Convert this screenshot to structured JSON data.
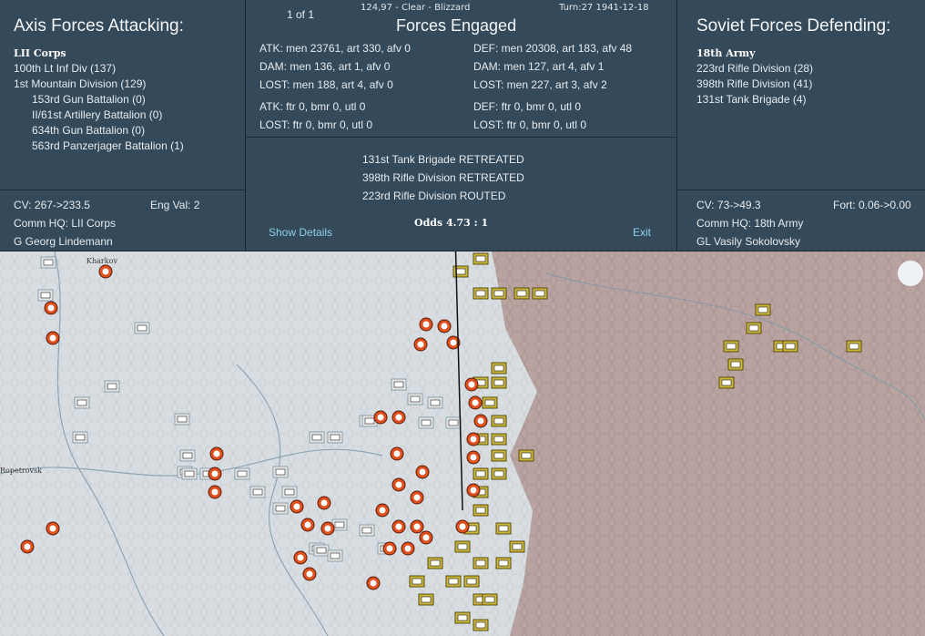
{
  "attacker": {
    "heading": "Axis Forces Attacking:",
    "hq_name": "LII Corps",
    "units": [
      "100th Lt Inf Div (137)",
      "1st Mountain Division (129)",
      "153rd Gun Battalion (0)",
      "II/61st Artillery Battalion (0)",
      "634th Gun Battalion (0)",
      "563rd Panzerjager Battalion (1)"
    ],
    "cv": "CV: 267->233.5",
    "eng_val": "Eng Val: 2",
    "comm_hq": "Comm HQ: LII Corps",
    "commander": "G Georg Lindemann"
  },
  "engagement": {
    "page": "1 of 1",
    "coords_weather": "124,97 - Clear - Blizzard",
    "turn": "Turn:27  1941-12-18",
    "heading": "Forces Engaged",
    "atk": "ATK: men 23761, art 330, afv 0",
    "dam_atk": "DAM: men 136, art 1, afv 0",
    "lost_atk": "LOST: men 188, art 4, afv 0",
    "atk_air": "ATK: ftr 0, bmr 0, utl 0",
    "lost_atk_air": "LOST: ftr 0, bmr 0, utl 0",
    "def": "DEF: men 20308, art 183, afv 48",
    "dam_def": "DAM: men 127, art 4, afv 1",
    "lost_def": "LOST: men 227, art 3, afv 2",
    "def_air": "DEF: ftr 0, bmr 0, utl 0",
    "lost_def_air": "LOST: ftr 0, bmr 0, utl 0",
    "results": [
      "131st Tank Brigade RETREATED",
      "398th Rifle Division RETREATED",
      "223rd Rifle Division ROUTED"
    ],
    "show_details": "Show Details",
    "odds": "Odds 4.73 : 1",
    "exit": "Exit"
  },
  "defender": {
    "heading": "Soviet Forces Defending:",
    "hq_name": "18th Army",
    "units": [
      "223rd Rifle Division (28)",
      "398th Rifle Division (41)",
      "131st Tank Brigade (4)"
    ],
    "cv": "CV: 73->49.3",
    "fort": "Fort: 0.06->0.00",
    "comm_hq": "Comm HQ: 18th Army",
    "commander": "GL Vasily Sokolovsky"
  },
  "map": {
    "town_labels": [
      "Kharkov",
      "Ropetrovsk"
    ],
    "colors": {
      "snow": "#d9dee2",
      "steppe": "#b9a4a1",
      "axis_counter": "#e6e6e6",
      "axis_counter_border": "#8aa0aa",
      "soviet_counter": "#c9b53a",
      "soviet_counter_border": "#5a4f10",
      "artillery_disc": "#e0501e"
    }
  }
}
